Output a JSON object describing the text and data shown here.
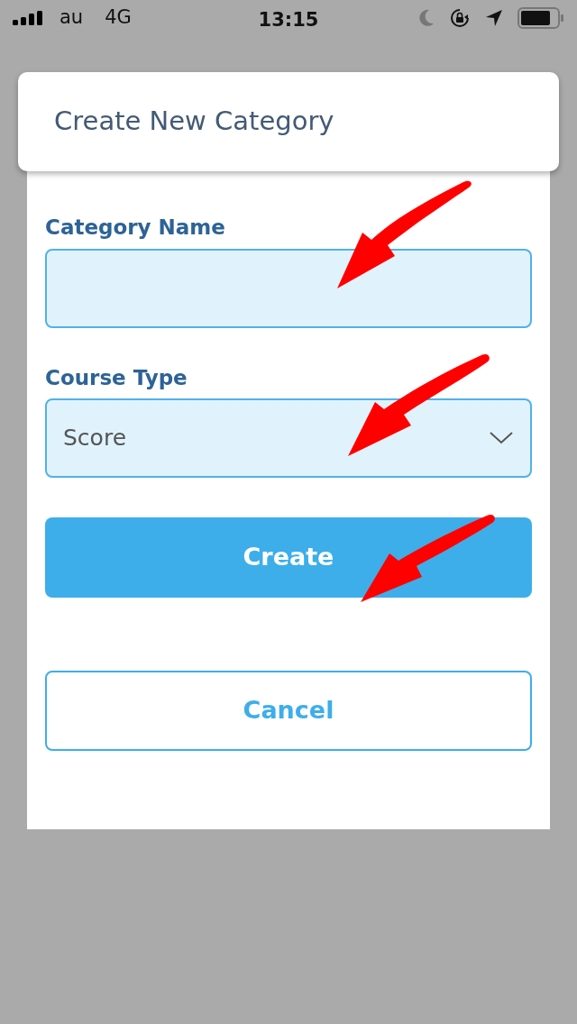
{
  "status_bar": {
    "carrier": "au",
    "network": "4G",
    "time": "13:15"
  },
  "dialog": {
    "title": "Create New Category",
    "fields": [
      {
        "kind": "text",
        "label": "Category Name"
      },
      {
        "kind": "select",
        "label": "Course Type",
        "value": "Score"
      }
    ],
    "buttons": [
      {
        "kind": "primary",
        "label": "Create"
      },
      {
        "kind": "secondary",
        "label": "Cancel"
      }
    ]
  }
}
